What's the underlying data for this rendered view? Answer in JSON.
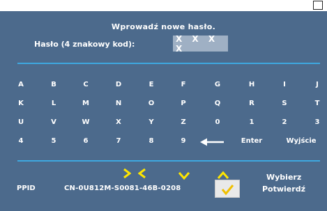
{
  "title": "Wprowadź nowe hasło.",
  "password": {
    "label": "Hasło (4 znakowy kod):",
    "value": "X X X X"
  },
  "keyboard": {
    "rows": [
      [
        "A",
        "B",
        "C",
        "D",
        "E",
        "F",
        "G",
        "H",
        "I",
        "J"
      ],
      [
        "K",
        "L",
        "M",
        "N",
        "O",
        "P",
        "Q",
        "R",
        "S",
        "T"
      ],
      [
        "U",
        "V",
        "W",
        "X",
        "Y",
        "Z",
        "0",
        "1",
        "2",
        "3"
      ],
      [
        "4",
        "5",
        "6",
        "7",
        "8",
        "9"
      ]
    ],
    "backspace_icon": "left-arrow-icon",
    "enter_label": "Enter",
    "exit_label": "Wyjście"
  },
  "footer": {
    "ppid_label": "PPID",
    "ppid_value": "CN-0U812M-S0081-46B-0208",
    "select_label": "Wybierz",
    "confirm_label": "Potwierdź",
    "nav_icons": [
      "chevron-right-icon",
      "chevron-left-icon",
      "chevron-down-icon",
      "chevron-up-icon"
    ],
    "confirm_icon": "checkmark-icon"
  },
  "colors": {
    "background": "#4c6a8c",
    "divider": "#3ea8e0",
    "nav_icons": "#ffe600",
    "check": "#f0c000",
    "field_bg": "#9fb0c4"
  }
}
